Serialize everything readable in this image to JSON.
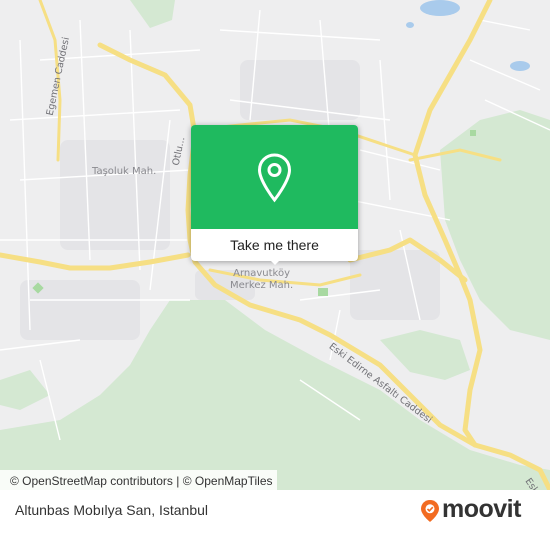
{
  "map": {
    "places": {
      "tasoluk": "Taşoluk Mah.",
      "arnavutkoy_line1": "Arnavutköy",
      "arnavutkoy_line2": "Merkez Mah."
    },
    "roads": {
      "egemen": "Egemen Caddesi",
      "cut_street": "Otlu...",
      "eski_edirne": "Eski Edirne Asfaltı Caddesi",
      "edge": "Esk"
    },
    "colors": {
      "land": "#eeeeef",
      "green": "#d4e8d2",
      "road": "#f6df84",
      "water": "#a9cbec"
    }
  },
  "popup": {
    "button_label": "Take me there",
    "color": "#1fba5f",
    "icon": "map-pin-icon"
  },
  "attribution": {
    "osm": "© OpenStreetMap contributors",
    "separator": "|",
    "omt": "© OpenMapTiles"
  },
  "footer": {
    "place_name": "Altunbas Mobılya San, Istanbul",
    "logo_text": "moovit",
    "logo_icon": "moovit-pin-icon",
    "logo_color": "#f26b21"
  }
}
